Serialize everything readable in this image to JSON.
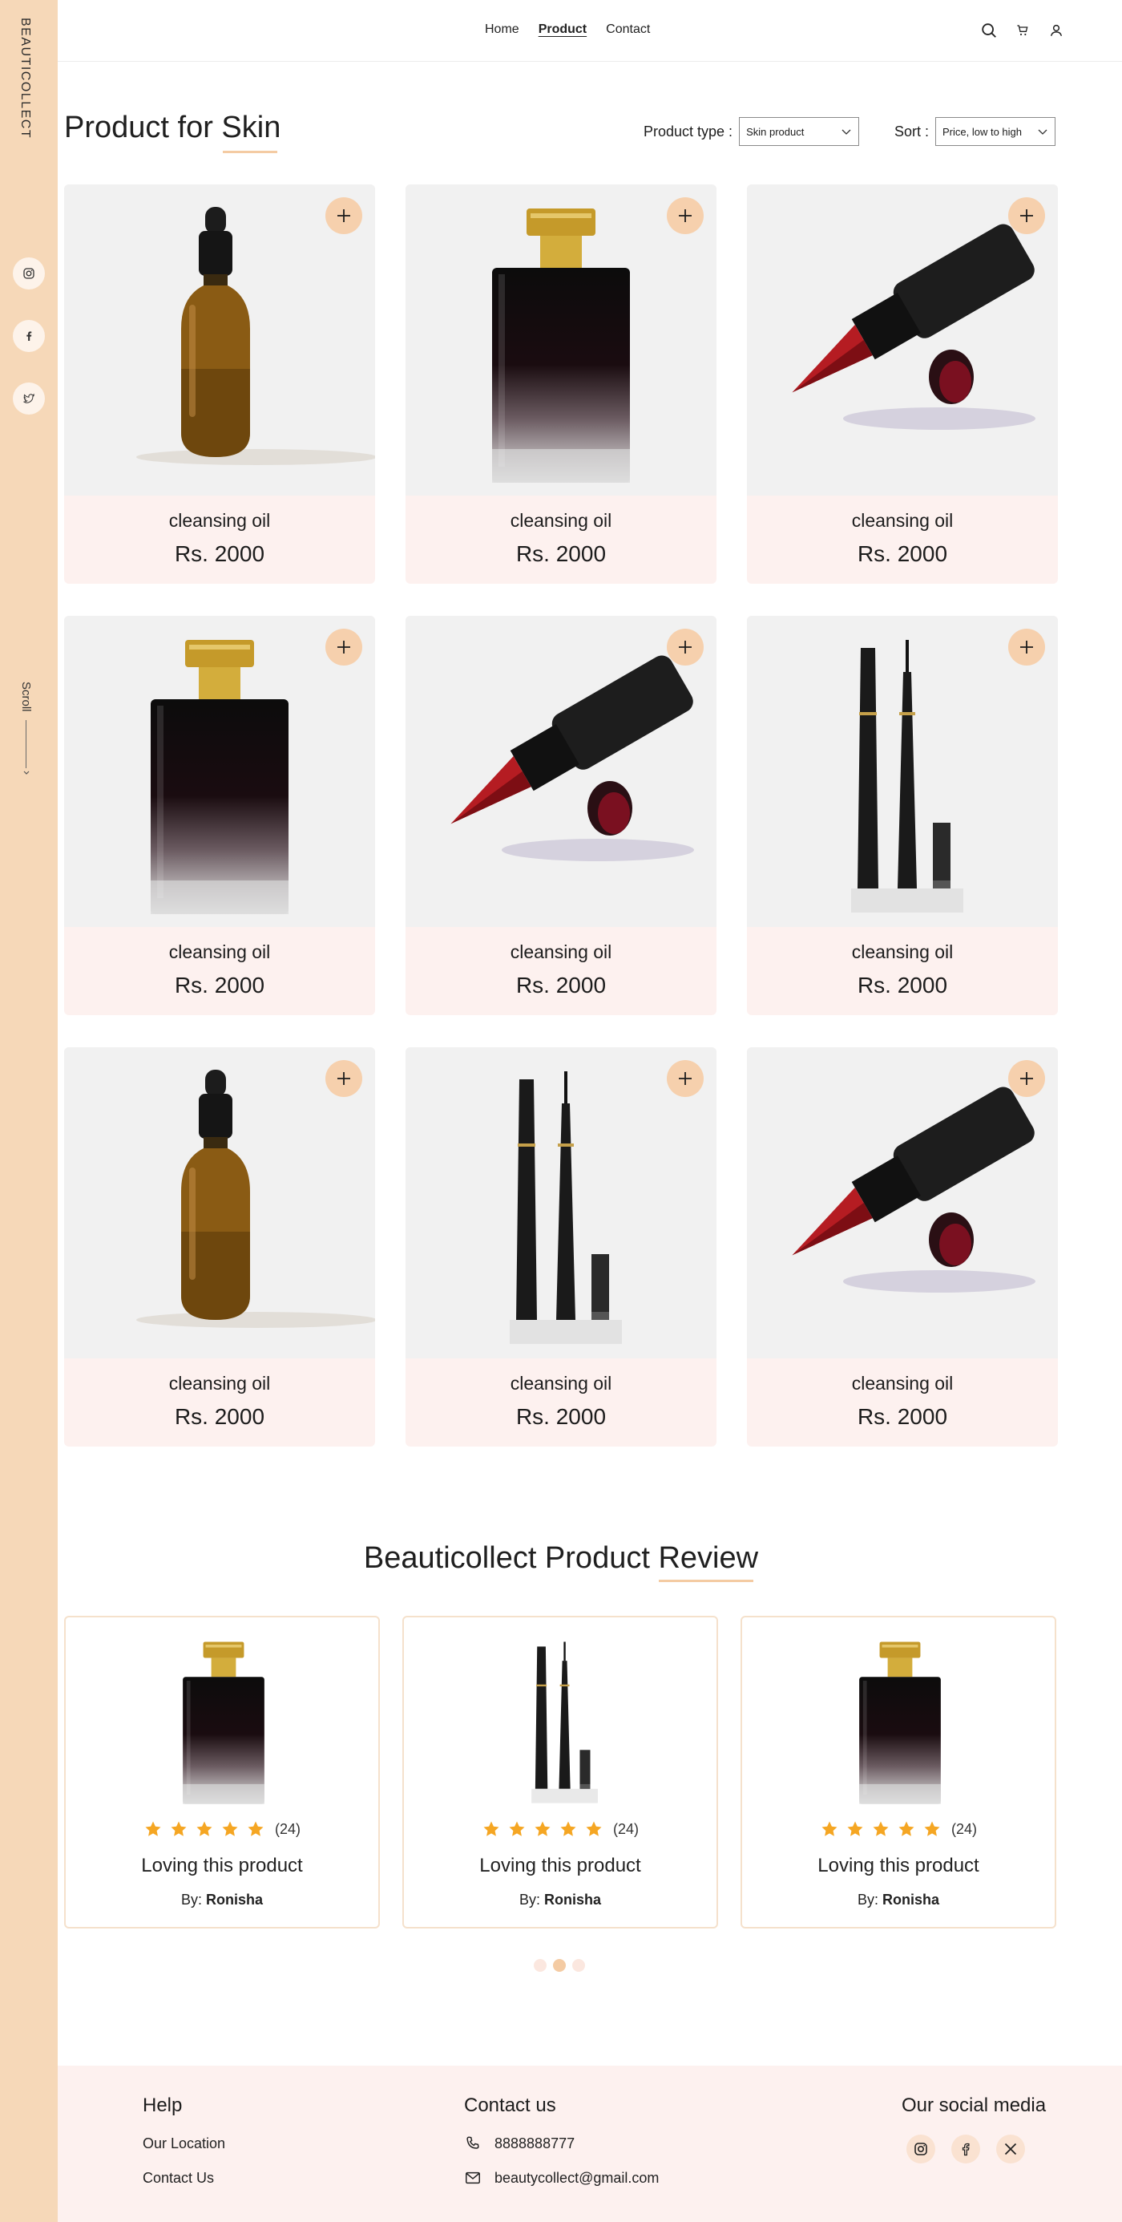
{
  "brand": "BEAUTICOLLECT",
  "nav": {
    "home": "Home",
    "product": "Product",
    "contact": "Contact"
  },
  "header_icons": [
    "search-icon",
    "cart-icon",
    "user-icon"
  ],
  "sidebar": {
    "social": [
      "instagram-icon",
      "facebook-icon",
      "twitter-icon"
    ],
    "scroll_label": "Scroll"
  },
  "page": {
    "title_prefix": "Product for ",
    "title_highlight": "Skin",
    "product_type_label": "Product type :",
    "product_type_value": "Skin product",
    "sort_label": "Sort :",
    "sort_value": "Price, low to high"
  },
  "products": [
    {
      "name": "cleansing oil",
      "price": "Rs. 2000",
      "image": "dropper-bottle"
    },
    {
      "name": "cleansing oil",
      "price": "Rs. 2000",
      "image": "perfume-bottle"
    },
    {
      "name": "cleansing oil",
      "price": "Rs. 2000",
      "image": "lipstick"
    },
    {
      "name": "cleansing oil",
      "price": "Rs. 2000",
      "image": "perfume-bottle"
    },
    {
      "name": "cleansing oil",
      "price": "Rs. 2000",
      "image": "lipstick"
    },
    {
      "name": "cleansing oil",
      "price": "Rs. 2000",
      "image": "eyeliner"
    },
    {
      "name": "cleansing oil",
      "price": "Rs. 2000",
      "image": "dropper-bottle"
    },
    {
      "name": "cleansing oil",
      "price": "Rs. 2000",
      "image": "eyeliner"
    },
    {
      "name": "cleansing oil",
      "price": "Rs. 2000",
      "image": "lipstick"
    }
  ],
  "reviews_section": {
    "title": "Beauticollect Product Review",
    "items": [
      {
        "image": "perfume-bottle",
        "rating": 5,
        "count": "(24)",
        "text": "Loving this product",
        "by_label": "By:",
        "author": "Ronisha"
      },
      {
        "image": "eyeliner",
        "rating": 5,
        "count": "(24)",
        "text": "Loving this product",
        "by_label": "By:",
        "author": "Ronisha"
      },
      {
        "image": "perfume-bottle",
        "rating": 5,
        "count": "(24)",
        "text": "Loving this product",
        "by_label": "By:",
        "author": "Ronisha"
      }
    ],
    "pagination_active": 2
  },
  "footer": {
    "help": {
      "title": "Help",
      "location": "Our Location",
      "contact_us": "Contact Us"
    },
    "contact": {
      "title": "Contact us",
      "phone": "8888888777",
      "email": "beautycollect@gmail.com"
    },
    "social": {
      "title": "Our social media",
      "icons": [
        "instagram-icon",
        "facebook-icon",
        "x-icon"
      ]
    }
  },
  "colors": {
    "sidebar": "#f6d8b8",
    "accent": "#f4cba3",
    "card_bg": "#fdf1ef",
    "star": "#f5a623"
  }
}
